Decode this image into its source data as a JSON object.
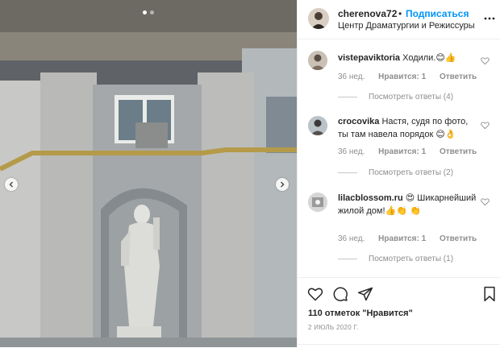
{
  "post": {
    "username": "cherenova72",
    "separator": "•",
    "follow_label": "Подписаться",
    "location": "Центр Драматургии и Режиссуры"
  },
  "comments": [
    {
      "username": "vistepaviktoria",
      "text": "Ходили.😊👍",
      "time": "36 нед.",
      "likes": "Нравится: 1",
      "reply": "Ответить",
      "replies": "Посмотреть ответы (4)"
    },
    {
      "username": "crocovika",
      "text": "Настя, судя по фото, ты там навела порядок 😊👌",
      "time": "36 нед.",
      "likes": "Нравится: 1",
      "reply": "Ответить",
      "replies": "Посмотреть ответы (2)"
    },
    {
      "username": "lilacblossom.ru",
      "text": "😍 Шикарнейший жилой дом!👍👏 👏",
      "time": "36 нед.",
      "likes": "Нравится: 1",
      "reply": "Ответить",
      "replies": "Посмотреть ответы (1)"
    }
  ],
  "footer": {
    "likes_count": "110 отметок \"Нравится\"",
    "date": "2 июль 2020 г."
  },
  "icons": {
    "header_more": "more-icon",
    "comment_like": "heart-icon",
    "like": "heart-icon",
    "comment": "comment-icon",
    "share": "share-icon",
    "save": "bookmark-icon",
    "prev": "chevron-left-icon",
    "next": "chevron-right-icon"
  },
  "colors": {
    "accent": "#0095f6",
    "text": "#262626",
    "muted": "#8e8e8e"
  }
}
